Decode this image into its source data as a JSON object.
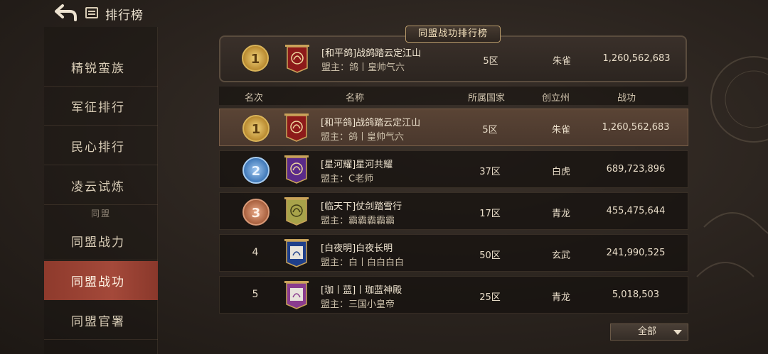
{
  "header": {
    "title": "排行榜",
    "back_icon": "back-arrow-icon",
    "title_icon": "list-icon"
  },
  "sidebar": {
    "items_top": [
      {
        "label": "精锐蛮族"
      },
      {
        "label": "军征排行"
      },
      {
        "label": "民心排行"
      },
      {
        "label": "凌云试炼"
      }
    ],
    "group_label": "同盟",
    "items_group": [
      {
        "label": "同盟战力",
        "active": false
      },
      {
        "label": "同盟战功",
        "active": true
      },
      {
        "label": "同盟官署",
        "active": false
      }
    ]
  },
  "board": {
    "tab_label": "同盟战功排行榜",
    "my_alliance": {
      "rank": "1",
      "name": "[和平鸽]战鸽踏云定江山",
      "leader": "盟主：鸽丨皇帅气六",
      "zone": "5区",
      "state": "朱雀",
      "merit": "1,260,562,683"
    }
  },
  "table": {
    "columns": {
      "rank": "名次",
      "name": "名称",
      "country": "所属国家",
      "state": "创立州",
      "merit": "战功"
    },
    "rows": [
      {
        "rank": "1",
        "medal": "gold",
        "banner_color": "#8d1a1a",
        "name": "[和平鸽]战鸽踏云定江山",
        "leader": "盟主：鸽丨皇帅气六",
        "zone": "5区",
        "state": "朱雀",
        "merit": "1,260,562,683"
      },
      {
        "rank": "2",
        "medal": "silver-blue",
        "banner_color": "#5a2a8a",
        "name": "[星河耀]星河共耀",
        "leader": "盟主：C老师",
        "zone": "37区",
        "state": "白虎",
        "merit": "689,723,896"
      },
      {
        "rank": "3",
        "medal": "bronze",
        "banner_color": "#a8a34a",
        "name": "[临天下]仗剑踏雪行",
        "leader": "盟主：霸霸霸霸霸",
        "zone": "17区",
        "state": "青龙",
        "merit": "455,475,644"
      },
      {
        "rank": "4",
        "medal": "",
        "banner_color": "#1f3f8a",
        "name": "[白夜明]白夜长明",
        "leader": "盟主：白丨白白白白",
        "zone": "50区",
        "state": "玄武",
        "merit": "241,990,525"
      },
      {
        "rank": "5",
        "medal": "",
        "banner_color": "#8a3c8e",
        "name": "[珈丨蓝]丨珈蓝神殿",
        "leader": "盟主：三国小皇帝",
        "zone": "25区",
        "state": "青龙",
        "merit": "5,018,503"
      }
    ]
  },
  "filter": {
    "label": "全部"
  },
  "colors": {
    "accent_red": "#a4493a",
    "gold": "#d9b45a"
  }
}
